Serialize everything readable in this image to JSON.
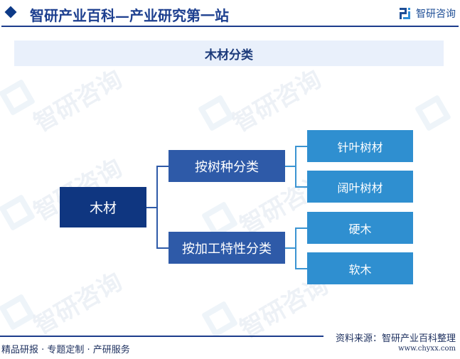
{
  "header": {
    "title": "智研产业百科—产业研究第一站",
    "brand_name": "智研咨询",
    "icons": {
      "bullet": "diamond-icon",
      "brand": "zhiyan-logo-icon"
    }
  },
  "diagram": {
    "title": "木材分类",
    "root": {
      "label": "木材"
    },
    "branches": [
      {
        "label": "按树种分类",
        "children": [
          {
            "label": "针叶树材"
          },
          {
            "label": "阔叶树材"
          }
        ]
      },
      {
        "label": "按加工特性分类",
        "children": [
          {
            "label": "硬木"
          },
          {
            "label": "软木"
          }
        ]
      }
    ],
    "colors": {
      "root": "#0f3680",
      "branch": "#2e5aa8",
      "leaf": "#2f8fd0"
    }
  },
  "footer": {
    "tagline": "精品研报 · 专题定制 · 产研服务",
    "source": "资料来源：智研产业百科整理",
    "url": "www.chyxx.com"
  },
  "watermark": {
    "text": "智研咨询"
  }
}
